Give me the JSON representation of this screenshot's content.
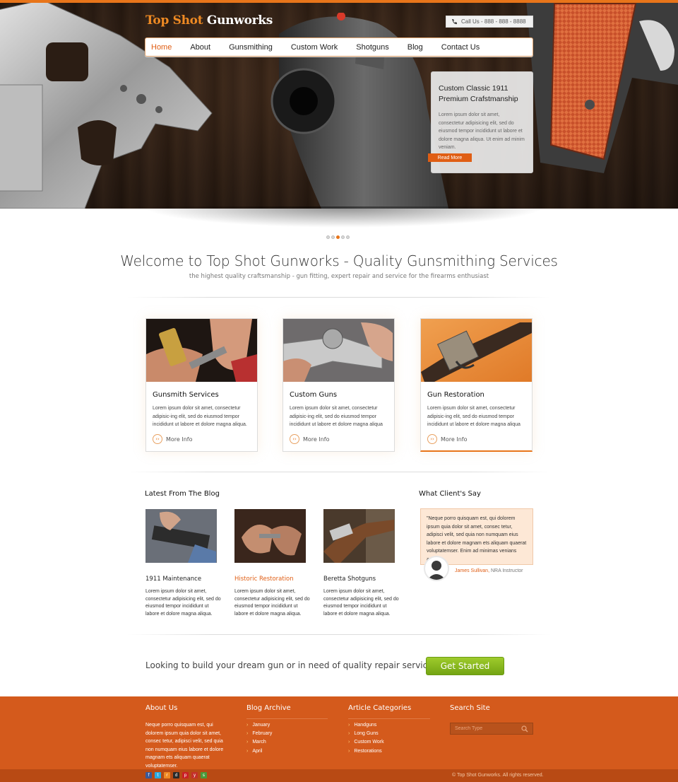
{
  "brand": {
    "part1": "Top Shot",
    "part2": "Gunworks"
  },
  "phone": {
    "text": "Call Us - 888 - 888 - 8888"
  },
  "nav": {
    "items": [
      {
        "label": "Home",
        "active": true
      },
      {
        "label": "About"
      },
      {
        "label": "Gunsmithing"
      },
      {
        "label": "Custom Work"
      },
      {
        "label": "Shotguns"
      },
      {
        "label": "Blog"
      },
      {
        "label": "Contact Us"
      }
    ]
  },
  "slide": {
    "title": "Custom Classic 1911 Premium Crafstmanship",
    "text": "Lorem ipsum dolor sit amet, consectetur adipisicing elit, sed do eiusmod tempor incididunt ut labore et dolore magna aliqua. Ut enim ad minim veniam.",
    "button": "Read More",
    "active_dot": 3,
    "dot_count": 5
  },
  "welcome": {
    "title": "Welcome to Top Shot Gunworks - Quality Gunsmithing Services",
    "subtitle": "the highest quality craftsmanship - gun fitting, expert repair and service for the firearms enthusiast"
  },
  "services": [
    {
      "title": "Gunsmith Services",
      "text": "Lorem ipsum dolor sit amet, consectetur adipisic-ing elit, sed do eiusmod tempor incididunt ut labore et dolore magna aliqua.",
      "link": "More Info"
    },
    {
      "title": "Custom Guns",
      "text": "Lorem ipsum dolor sit amet, consectetur adipisic-ing elit, sed do eiusmod tempor incididunt ut labore et dolore magna aliqua",
      "link": "More Info"
    },
    {
      "title": "Gun Restoration",
      "text": "Lorem ipsum dolor sit amet, consectetur adipisic-ing elit, sed do eiusmod tempor incididunt ut labore et dolore magna aliqua",
      "link": "More Info"
    }
  ],
  "blog": {
    "heading": "Latest From The Blog",
    "posts": [
      {
        "title": "1911 Maintenance",
        "text": "Lorem ipsum dolor sit amet, consectetur adipisicing elit, sed do eiusmod tempor incididunt ut labore et dolore magna aliqua."
      },
      {
        "title": "Historic Restoration",
        "text": "Lorem ipsum dolor sit amet, consectetur adipisicing elit, sed do eiusmod tempor incididunt ut labore et dolore magna aliqua."
      },
      {
        "title": "Beretta Shotguns",
        "text": "Lorem ipsum dolor sit amet, consectetur adipisicing elit, sed do eiusmod tempor incididunt ut labore et dolore magna aliqua."
      }
    ]
  },
  "testimonial": {
    "heading": "What Client's Say",
    "quote": "\"Neque porro quisquam est, qui dolorem ipsum quia dolor sit amet, consec tetur, adipisci velit, sed quia non numquam eius labore et dolore magnam ets aliquam quaerat voluptatemser.  Enim ad minimas venians amets",
    "author_name": "James Sullivan,",
    "author_title": " NRA Instructor"
  },
  "cta": {
    "text": "Looking to build your dream gun or in need of quality repair services?",
    "button": "Get Started"
  },
  "footer": {
    "about": {
      "heading": "About Us",
      "text": "Neque porro quisquam est, qui dolorem ipsum quia dolor sit amet, consec tetur, adipisci velit, sed quia non numquam eius labore et dolore magnam ets aliquam quaerat voluptatemser."
    },
    "archive": {
      "heading": "Blog Archive",
      "items": [
        "January",
        "February",
        "March",
        "April"
      ]
    },
    "categories": {
      "heading": "Article Categories",
      "items": [
        "Handguns",
        "Long Guns",
        "Custom Work",
        "Restorations"
      ]
    },
    "search": {
      "heading": "Search Site",
      "placeholder": "Search Type"
    },
    "copyright": "© Top Shot Gunworks. All rights reserved.",
    "socials": [
      "facebook-icon",
      "twitter-icon",
      "rss-icon",
      "digg-icon",
      "pinterest-icon",
      "youtube-icon",
      "share-icon"
    ]
  },
  "colors": {
    "accent": "#e05e14",
    "footer": "#d45a1c",
    "cta": "#8cbf22"
  }
}
